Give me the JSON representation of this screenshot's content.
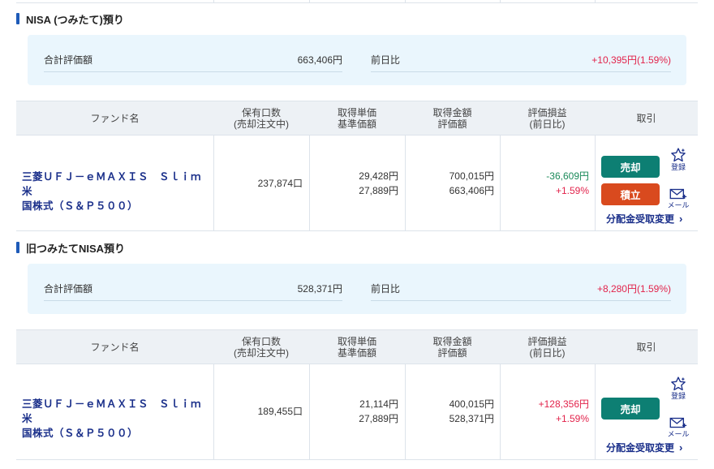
{
  "sections": [
    {
      "title": "NISA (つみたて)預り",
      "summary": {
        "total_label": "合計評価額",
        "total_value": "663,406円",
        "change_label": "前日比",
        "change_value": "+10,395円(1.59%)"
      },
      "table": {
        "headers": {
          "fund": "ファンド名",
          "units_1": "保有口数",
          "units_2": "(売却注文中)",
          "unit_price_1": "取得単価",
          "unit_price_2": "基準価額",
          "amount_1": "取得金額",
          "amount_2": "評価額",
          "pnl_1": "評価損益",
          "pnl_2": "(前日比)",
          "trade": "取引"
        },
        "row": {
          "fund_name_1": "三菱ＵＦＪ－ｅＭＡＸＩＳ　Ｓｌｉｍ　米",
          "fund_name_2": "国株式（Ｓ＆Ｐ５００）",
          "units": "237,874口",
          "acq_unit_price": "29,428円",
          "base_price": "27,889円",
          "acq_amount": "700,015円",
          "eval_amount": "663,406円",
          "pnl": "-36,609円",
          "day_change": "+1.59%",
          "sell_label": "売却",
          "tsumitate_label": "積立",
          "register_label": "登録",
          "mail_label": "メール",
          "dividend_link": "分配金受取変更"
        }
      }
    },
    {
      "title": "旧つみたてNISA預り",
      "summary": {
        "total_label": "合計評価額",
        "total_value": "528,371円",
        "change_label": "前日比",
        "change_value": "+8,280円(1.59%)"
      },
      "table": {
        "headers": {
          "fund": "ファンド名",
          "units_1": "保有口数",
          "units_2": "(売却注文中)",
          "unit_price_1": "取得単価",
          "unit_price_2": "基準価額",
          "amount_1": "取得金額",
          "amount_2": "評価額",
          "pnl_1": "評価損益",
          "pnl_2": "(前日比)",
          "trade": "取引"
        },
        "row": {
          "fund_name_1": "三菱ＵＦＪ－ｅＭＡＸＩＳ　Ｓｌｉｍ　米",
          "fund_name_2": "国株式（Ｓ＆Ｐ５００）",
          "units": "189,455口",
          "acq_unit_price": "21,114円",
          "base_price": "27,889円",
          "acq_amount": "400,015円",
          "eval_amount": "528,371円",
          "pnl": "+128,356円",
          "day_change": "+1.59%",
          "sell_label": "売却",
          "register_label": "登録",
          "mail_label": "メール",
          "dividend_link": "分配金受取変更"
        }
      }
    }
  ],
  "icons": {
    "star": "star-outline-icon",
    "mail": "mail-plus-icon",
    "chevron": "chevron-right-icon"
  },
  "colors": {
    "brand_blue": "#1a2f8a",
    "accent_blue": "#1e5bb8",
    "positive": "#e2234b",
    "negative": "#1b8a5a",
    "sell_button": "#0d7f73",
    "tsumitate_button": "#d94a1e",
    "summary_bg": "#eaf6fd",
    "header_bg": "#edf1f5"
  }
}
